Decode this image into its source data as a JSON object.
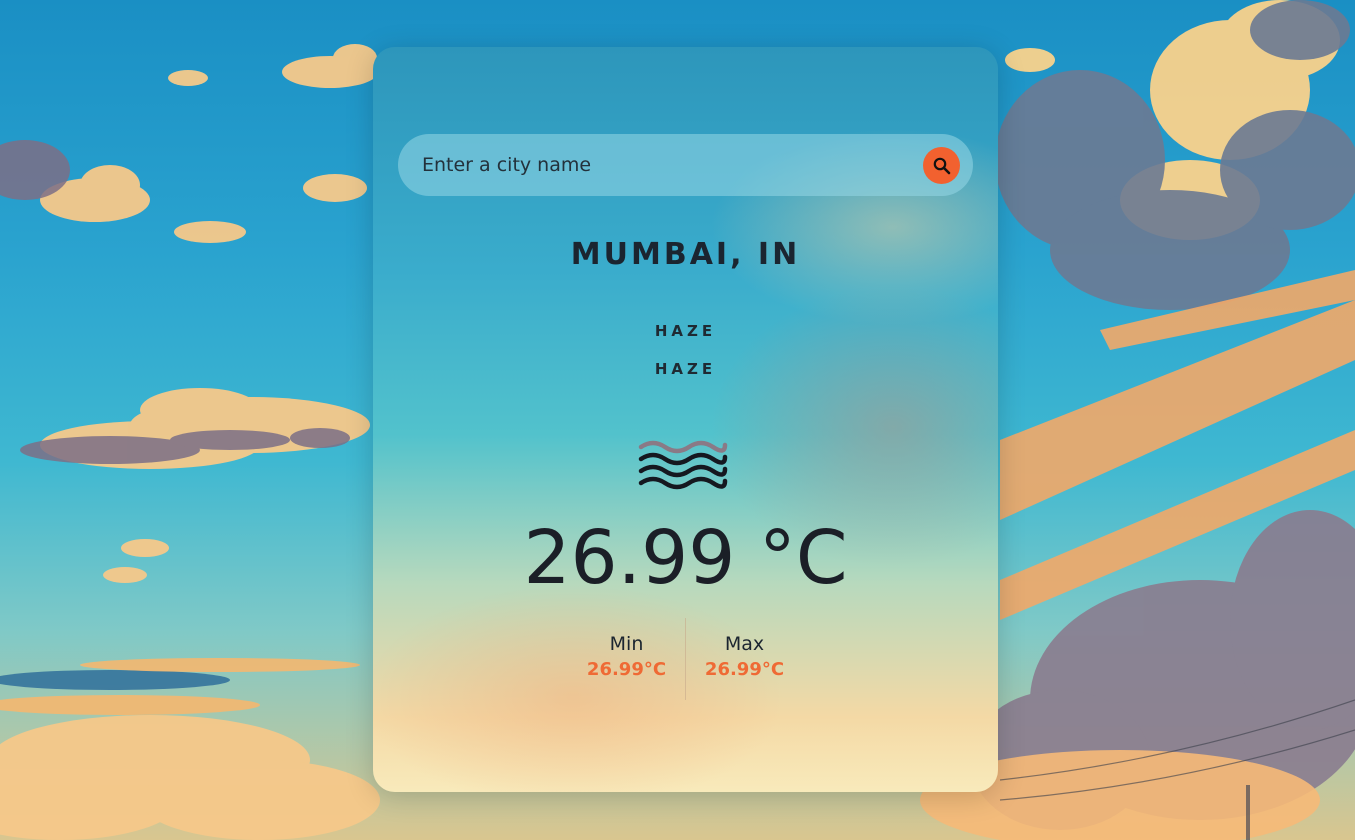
{
  "search": {
    "placeholder": "Enter a city name",
    "icon": "search-icon"
  },
  "location": {
    "city": "MUMBAI, IN"
  },
  "condition": {
    "main": "HAZE",
    "description": "HAZE",
    "icon": "haze-icon"
  },
  "temperature": {
    "current": "26.99 °C",
    "min_label": "Min",
    "min_value": "26.99°C",
    "max_label": "Max",
    "max_value": "26.99°C"
  },
  "colors": {
    "accent": "#f2612f",
    "minmax_value": "#ef6a35",
    "text_dark": "#1b2530"
  }
}
